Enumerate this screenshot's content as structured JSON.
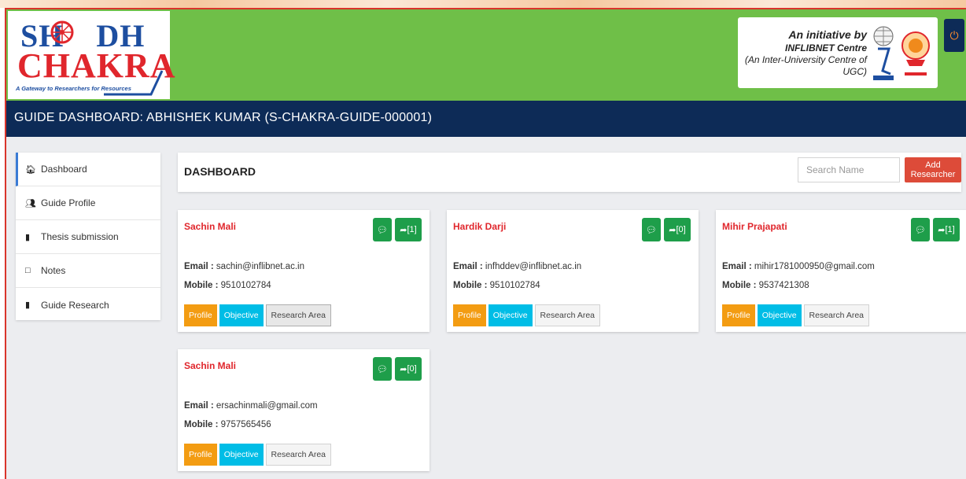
{
  "logo": {
    "shodh": "SH DH",
    "chakra": "CHAKRA",
    "tagline": "A Gateway to Researchers for Resources"
  },
  "initiative": {
    "line1": "An initiative by",
    "line2": "INFLIBNET Centre",
    "line3": "(An Inter-University Centre of UGC)"
  },
  "title_bar": "GUIDE DASHBOARD: ABHISHEK KUMAR (S-CHAKRA-GUIDE-000001)",
  "sidebar": {
    "items": [
      {
        "label": "Dashboard",
        "icon": "home-icon"
      },
      {
        "label": "Guide Profile",
        "icon": "users-icon"
      },
      {
        "label": "Thesis submission",
        "icon": "book-icon"
      },
      {
        "label": "Notes",
        "icon": "note-icon"
      },
      {
        "label": "Guide Research",
        "icon": "book-icon"
      }
    ]
  },
  "dashboard": {
    "title": "DASHBOARD",
    "search_placeholder": "Search Name",
    "add_button": "Add Researcher"
  },
  "labels": {
    "email": "Email :",
    "mobile": "Mobile :",
    "profile": "Profile",
    "objective": "Objective",
    "research_area": "Research Area"
  },
  "researchers": [
    {
      "name": "Sachin Mali",
      "share_count": "[1]",
      "email": "sachin@inflibnet.ac.in",
      "mobile": "9510102784"
    },
    {
      "name": "Hardik Darji",
      "share_count": "[0]",
      "email": "infhddev@inflibnet.ac.in",
      "mobile": "9510102784"
    },
    {
      "name": "Mihir Prajapati",
      "share_count": "[1]",
      "email": "mihir1781000950@gmail.com",
      "mobile": "9537421308"
    },
    {
      "name": "Sachin Mali",
      "share_count": "[0]",
      "email": "ersachinmali@gmail.com",
      "mobile": "9757565456"
    }
  ],
  "colors": {
    "header_green": "#6fbf48",
    "navy": "#0d2b57",
    "name_red": "#e0262c",
    "action_green": "#1e9e4a",
    "profile_orange": "#f39c12",
    "objective_cyan": "#00bde6",
    "add_red": "#dd4b39"
  }
}
